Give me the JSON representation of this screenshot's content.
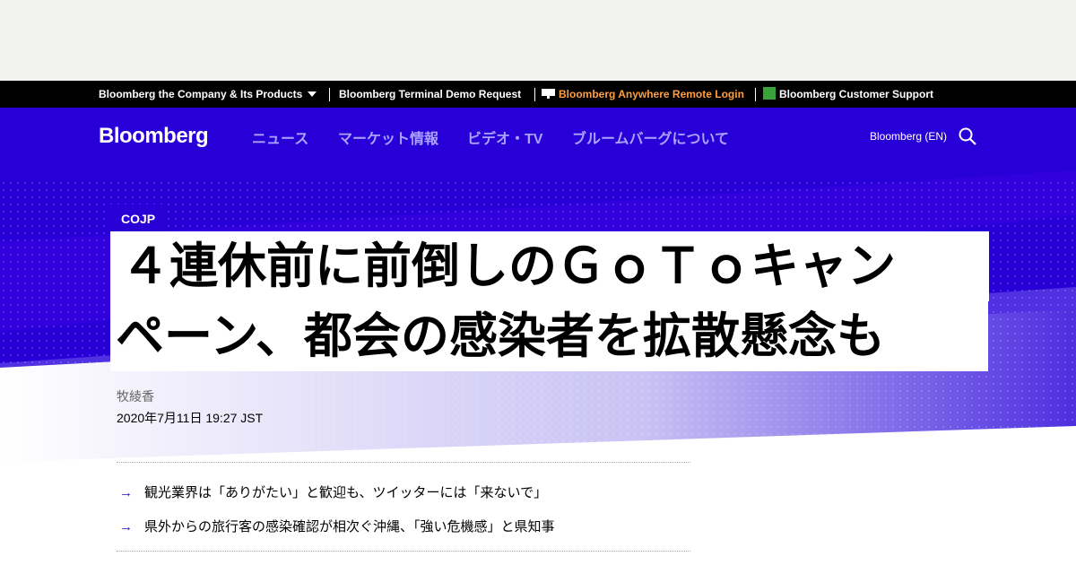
{
  "topbar": {
    "company": "Bloomberg the Company & Its Products",
    "terminal": "Bloomberg Terminal Demo Request",
    "anywhere": "Bloomberg Anywhere Remote Login",
    "support": "Bloomberg Customer Support",
    "anywhere_color": "#ff9f40"
  },
  "header": {
    "logo": "Bloomberg",
    "nav": [
      "ニュース",
      "マーケット情報",
      "ビデオ・TV",
      "ブルームバーグについて"
    ],
    "lang": "Bloomberg (EN)"
  },
  "article": {
    "tag": "COJP",
    "headline": [
      "４連休前に前倒しのＧｏＴｏキャン",
      "ペーン、都会の感染者を拡散懸念も"
    ],
    "author": "牧綾香",
    "date": "2020年7月11日 19:27 JST",
    "bullets": [
      "観光業界は「ありがたい」と歓迎も、ツイッターには「来ないで」",
      "県外からの旅行客の感染確認が相次ぐ沖縄、「強い危機感」と県知事"
    ]
  },
  "colors": {
    "brand_blue": "#2a00d6",
    "hero_blue": "#2800d7",
    "nav_text": "#a9a3ff"
  }
}
